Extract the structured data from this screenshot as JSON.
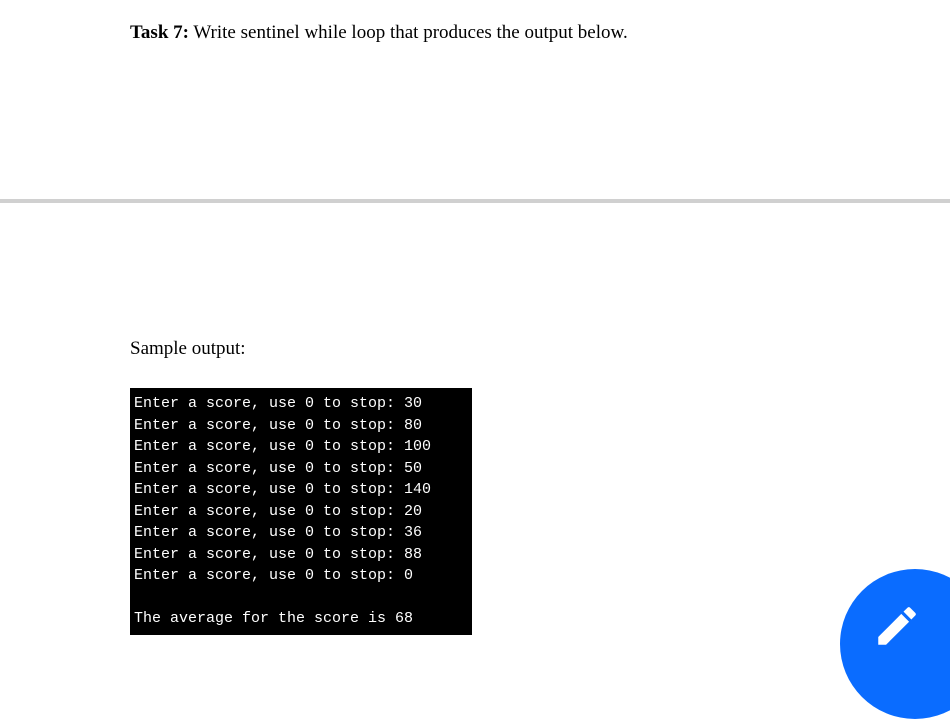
{
  "task": {
    "label": "Task 7:",
    "description": " Write sentinel while loop that produces the output below."
  },
  "sample_output_label": "Sample output:",
  "terminal_lines": [
    "Enter a score, use 0 to stop: 30",
    "Enter a score, use 0 to stop: 80",
    "Enter a score, use 0 to stop: 100",
    "Enter a score, use 0 to stop: 50",
    "Enter a score, use 0 to stop: 140",
    "Enter a score, use 0 to stop: 20",
    "Enter a score, use 0 to stop: 36",
    "Enter a score, use 0 to stop: 88",
    "Enter a score, use 0 to stop: 0",
    "",
    "The average for the score is 68"
  ]
}
